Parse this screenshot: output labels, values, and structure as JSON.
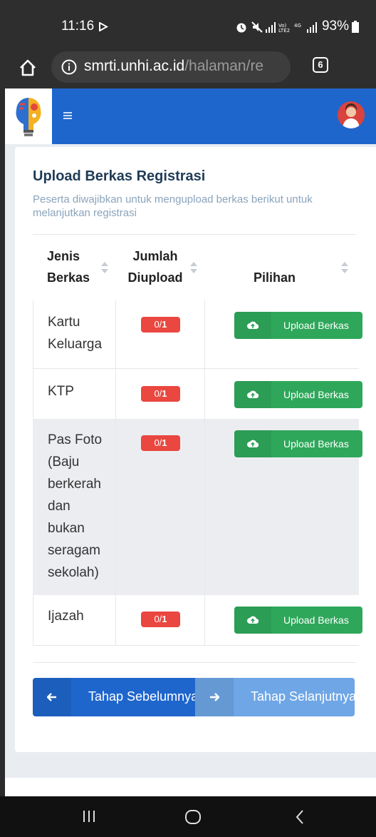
{
  "statusbar": {
    "time": "11:16",
    "battery": "93%"
  },
  "browser": {
    "url_host": "smrti.unhi.ac.id",
    "url_path": "/halaman/re",
    "tab_count": "6"
  },
  "card": {
    "title": "Upload Berkas Registrasi",
    "subtitle": "Peserta diwajibkan untuk mengupload berkas berikut untuk melanjutkan registrasi"
  },
  "table": {
    "headers": {
      "col1": [
        "Jenis",
        "Berkas"
      ],
      "col2": [
        "Jumlah",
        "Diupload"
      ],
      "col3": "Pilihan"
    },
    "rows": [
      {
        "name": [
          "Kartu",
          "Keluarga"
        ],
        "count": "0/",
        "required": "1",
        "action": "Upload Berkas"
      },
      {
        "name": [
          "KTP"
        ],
        "count": "0/",
        "required": "1",
        "action": "Upload Berkas"
      },
      {
        "name": [
          "Pas Foto",
          "(Baju",
          "berkerah",
          "dan",
          "bukan",
          "seragam",
          "sekolah)"
        ],
        "count": "0/",
        "required": "1",
        "action": "Upload Berkas"
      },
      {
        "name": [
          "Ijazah"
        ],
        "count": "0/",
        "required": "1",
        "action": "Upload Berkas"
      }
    ]
  },
  "nav": {
    "prev_label": "Tahap Sebelumnya",
    "next_label": "Tahap Selanjutnya"
  },
  "colors": {
    "primary": "#1f66cc",
    "primary_light": "#6ea6e6",
    "success": "#2ea75a",
    "danger": "#e9473f"
  }
}
